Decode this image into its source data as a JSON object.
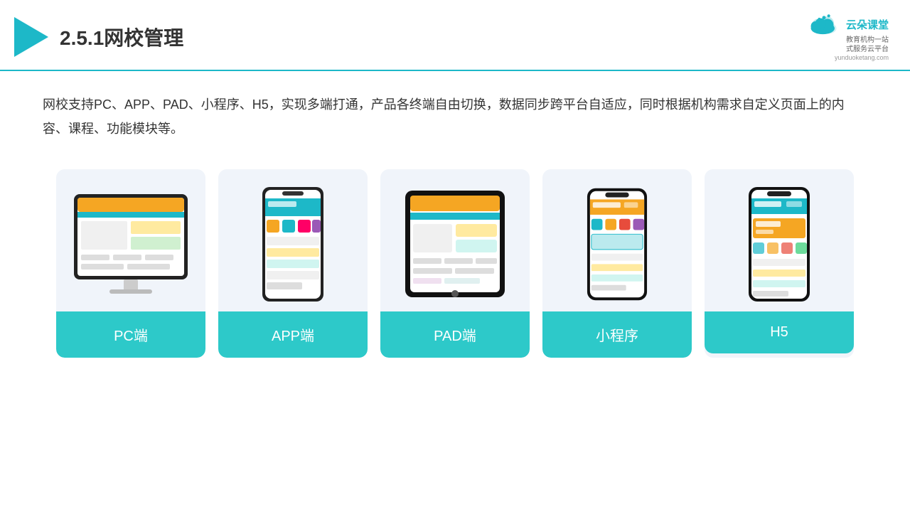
{
  "header": {
    "title": "2.5.1网校管理",
    "brand": {
      "name": "云朵课堂",
      "url": "yunduoketang.com",
      "tagline": "教育机构一站\n式服务云平台"
    }
  },
  "description": "网校支持PC、APP、PAD、小程序、H5，实现多端打通，产品各终端自由切换，数据同步跨平台自适应，同时根据机构需求自定义页面上的内容、课程、功能模块等。",
  "cards": [
    {
      "label": "PC端",
      "type": "monitor"
    },
    {
      "label": "APP端",
      "type": "phone"
    },
    {
      "label": "PAD端",
      "type": "tablet"
    },
    {
      "label": "小程序",
      "type": "phone2"
    },
    {
      "label": "H5",
      "type": "phone3"
    }
  ]
}
